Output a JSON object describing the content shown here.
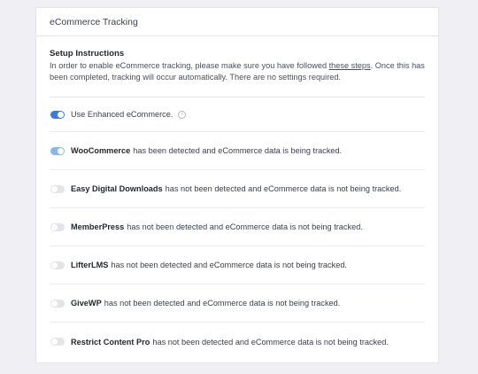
{
  "card": {
    "title": "eCommerce Tracking"
  },
  "setup": {
    "title": "Setup Instructions",
    "desc_before": "In order to enable eCommerce tracking, please make sure you have followed ",
    "link": "these steps",
    "desc_after": ". Once this has been completed, tracking will occur automatically. There are no settings required."
  },
  "enhanced": {
    "label": "Use Enhanced eCommerce.",
    "enabled": true
  },
  "integrations": [
    {
      "name": "WooCommerce",
      "status": "has been detected and eCommerce data is being tracked.",
      "enabled": true
    },
    {
      "name": "Easy Digital Downloads",
      "status": "has not been detected and eCommerce data is not being tracked.",
      "enabled": false
    },
    {
      "name": "MemberPress",
      "status": "has not been detected and eCommerce data is not being tracked.",
      "enabled": false
    },
    {
      "name": "LifterLMS",
      "status": "has not been detected and eCommerce data is not being tracked.",
      "enabled": false
    },
    {
      "name": "GiveWP",
      "status": "has not been detected and eCommerce data is not being tracked.",
      "enabled": false
    },
    {
      "name": "Restrict Content Pro",
      "status": "has not been detected and eCommerce data is not being tracked.",
      "enabled": false
    }
  ],
  "colors": {
    "toggle_on": "#3b7bd9",
    "toggle_detected": "#8cb6ee",
    "toggle_off": "#e2e4e8"
  },
  "icons": {
    "info": "info-circle-icon"
  }
}
